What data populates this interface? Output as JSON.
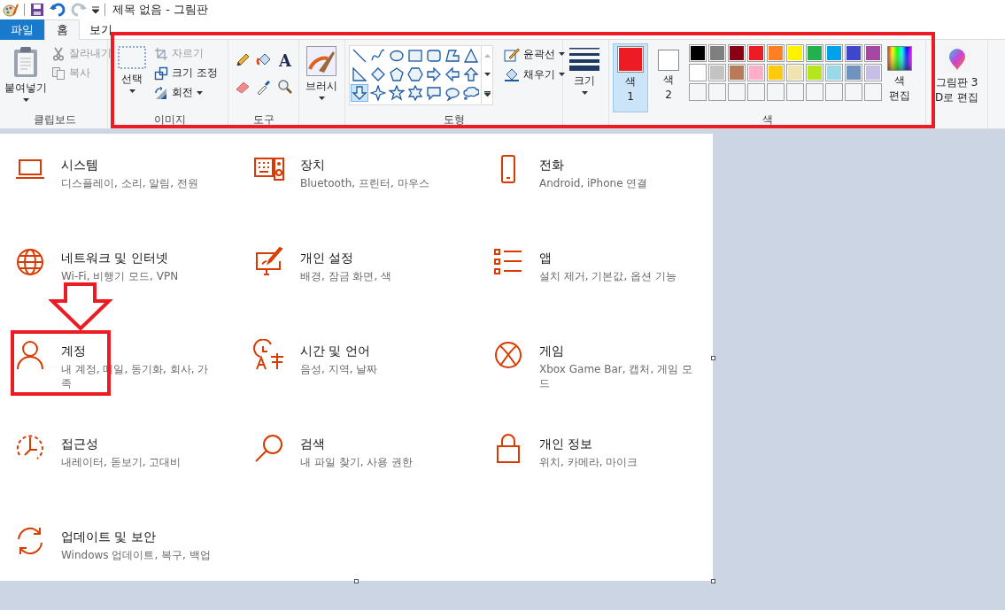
{
  "title_bar": {
    "title": "제목 없음 - 그림판"
  },
  "tabs": [
    {
      "label": "파일",
      "kind": "file",
      "selected": false
    },
    {
      "label": "홈",
      "kind": "tab",
      "selected": true
    },
    {
      "label": "보기",
      "kind": "tab",
      "selected": false
    }
  ],
  "ribbon": {
    "clipboard": {
      "label": "클립보드",
      "items": [
        {
          "kind": "paste",
          "label": "붙여넣기",
          "disabled": false
        },
        {
          "kind": "cut",
          "label": "잘라내기",
          "disabled": true
        },
        {
          "kind": "copy",
          "label": "복사",
          "disabled": true
        }
      ]
    },
    "image": {
      "label": "이미지",
      "items": [
        {
          "kind": "select",
          "label": "선택",
          "disabled": false
        },
        {
          "kind": "crop",
          "label": "자르기",
          "disabled": true
        },
        {
          "kind": "resize",
          "label": "크기 조정",
          "disabled": false
        },
        {
          "kind": "rotate",
          "label": "회전",
          "disabled": false
        }
      ]
    },
    "tools": {
      "label": "도구",
      "items": [
        {
          "kind": "pencil"
        },
        {
          "kind": "fill"
        },
        {
          "kind": "text",
          "glyph": "A"
        },
        {
          "kind": "eraser"
        },
        {
          "kind": "picker"
        },
        {
          "kind": "magnifier"
        }
      ]
    },
    "brushes": {
      "label": "브러시"
    },
    "shapes": {
      "label": "도형",
      "items": [
        {
          "kind": "line",
          "selected": false
        },
        {
          "kind": "curve",
          "selected": false
        },
        {
          "kind": "oval",
          "selected": false
        },
        {
          "kind": "rectangle",
          "selected": false
        },
        {
          "kind": "rounded-rectangle",
          "selected": false
        },
        {
          "kind": "polygon",
          "selected": false
        },
        {
          "kind": "triangle",
          "selected": false
        },
        {
          "kind": "right-triangle",
          "selected": false
        },
        {
          "kind": "diamond",
          "selected": false
        },
        {
          "kind": "pentagon",
          "selected": false
        },
        {
          "kind": "hexagon",
          "selected": false
        },
        {
          "kind": "right-arrow",
          "selected": false
        },
        {
          "kind": "left-arrow",
          "selected": false
        },
        {
          "kind": "up-arrow",
          "selected": false
        },
        {
          "kind": "down-arrow",
          "selected": true
        },
        {
          "kind": "star4",
          "selected": false
        },
        {
          "kind": "star5",
          "selected": false
        },
        {
          "kind": "star6",
          "selected": false
        },
        {
          "kind": "callout-rect",
          "selected": false
        },
        {
          "kind": "callout-oval",
          "selected": false
        },
        {
          "kind": "callout-cloud",
          "selected": false
        }
      ],
      "outline": {
        "label": "윤곽선"
      },
      "fill": {
        "label": "채우기"
      }
    },
    "size": {
      "label": "크기"
    },
    "colors": {
      "label": "색",
      "current": [
        {
          "label": "색 1",
          "color": "#ed1c24",
          "selected": true
        },
        {
          "label": "색 2",
          "color": "#ffffff",
          "selected": false
        }
      ],
      "palette": [
        {
          "kind": "swatch",
          "color": "#000000"
        },
        {
          "kind": "swatch",
          "color": "#7f7f7f"
        },
        {
          "kind": "swatch",
          "color": "#880015"
        },
        {
          "kind": "swatch",
          "color": "#ed1c24"
        },
        {
          "kind": "swatch",
          "color": "#ff7f27"
        },
        {
          "kind": "swatch",
          "color": "#fff200"
        },
        {
          "kind": "swatch",
          "color": "#22b14c"
        },
        {
          "kind": "swatch",
          "color": "#00a2e8"
        },
        {
          "kind": "swatch",
          "color": "#3f48cc"
        },
        {
          "kind": "swatch",
          "color": "#a349a4"
        },
        {
          "kind": "swatch",
          "color": "#ffffff"
        },
        {
          "kind": "swatch",
          "color": "#c3c3c3"
        },
        {
          "kind": "swatch",
          "color": "#b97a57"
        },
        {
          "kind": "swatch",
          "color": "#ffaec9"
        },
        {
          "kind": "swatch",
          "color": "#ffc90e"
        },
        {
          "kind": "swatch",
          "color": "#efe4b0"
        },
        {
          "kind": "swatch",
          "color": "#b5e61d"
        },
        {
          "kind": "swatch",
          "color": "#99d9ea"
        },
        {
          "kind": "swatch",
          "color": "#7092be"
        },
        {
          "kind": "swatch",
          "color": "#c8bfe7"
        },
        {
          "kind": "empty"
        },
        {
          "kind": "empty"
        },
        {
          "kind": "empty"
        },
        {
          "kind": "empty"
        },
        {
          "kind": "empty"
        },
        {
          "kind": "empty"
        },
        {
          "kind": "empty"
        },
        {
          "kind": "empty"
        },
        {
          "kind": "empty"
        },
        {
          "kind": "empty"
        }
      ],
      "edit": {
        "label": "색 편집"
      }
    },
    "paint3d": {
      "label": "그림판 3D로 편집"
    }
  },
  "canvas": {
    "settings": [
      {
        "kind": "laptop",
        "title": "시스템",
        "description": "디스플레이, 소리, 알림, 전원"
      },
      {
        "kind": "devices",
        "title": "장치",
        "description": "Bluetooth, 프린터, 마우스"
      },
      {
        "kind": "phone",
        "title": "전화",
        "description": "Android, iPhone 연결"
      },
      {
        "kind": "globe",
        "title": "네트워크 및 인터넷",
        "description": "Wi-Fi, 비행기 모드, VPN"
      },
      {
        "kind": "personalize",
        "title": "개인 설정",
        "description": "배경, 잠금 화면, 색"
      },
      {
        "kind": "apps",
        "title": "앱",
        "description": "설치 제거, 기본값, 옵션 기능"
      },
      {
        "kind": "person",
        "title": "계정",
        "description": "내 계정, 메일, 동기화, 회사, 가족"
      },
      {
        "kind": "time-language",
        "title": "시간 및 언어",
        "description": "음성, 지역, 날짜"
      },
      {
        "kind": "xbox",
        "title": "게임",
        "description": "Xbox Game Bar, 캡처, 게임 모드"
      },
      {
        "kind": "accessibility",
        "title": "접근성",
        "description": "내레이터, 돋보기, 고대비"
      },
      {
        "kind": "search",
        "title": "검색",
        "description": "내 파일 찾기, 사용 권한"
      },
      {
        "kind": "lock",
        "title": "개인 정보",
        "description": "위치, 카메라, 마이크"
      },
      {
        "kind": "sync",
        "title": "업데이트 및 보안",
        "description": "Windows 업데이트, 복구, 백업"
      }
    ],
    "annotations": [
      {
        "kind": "ribbon-box"
      },
      {
        "kind": "arrow"
      },
      {
        "kind": "account-box"
      }
    ]
  }
}
